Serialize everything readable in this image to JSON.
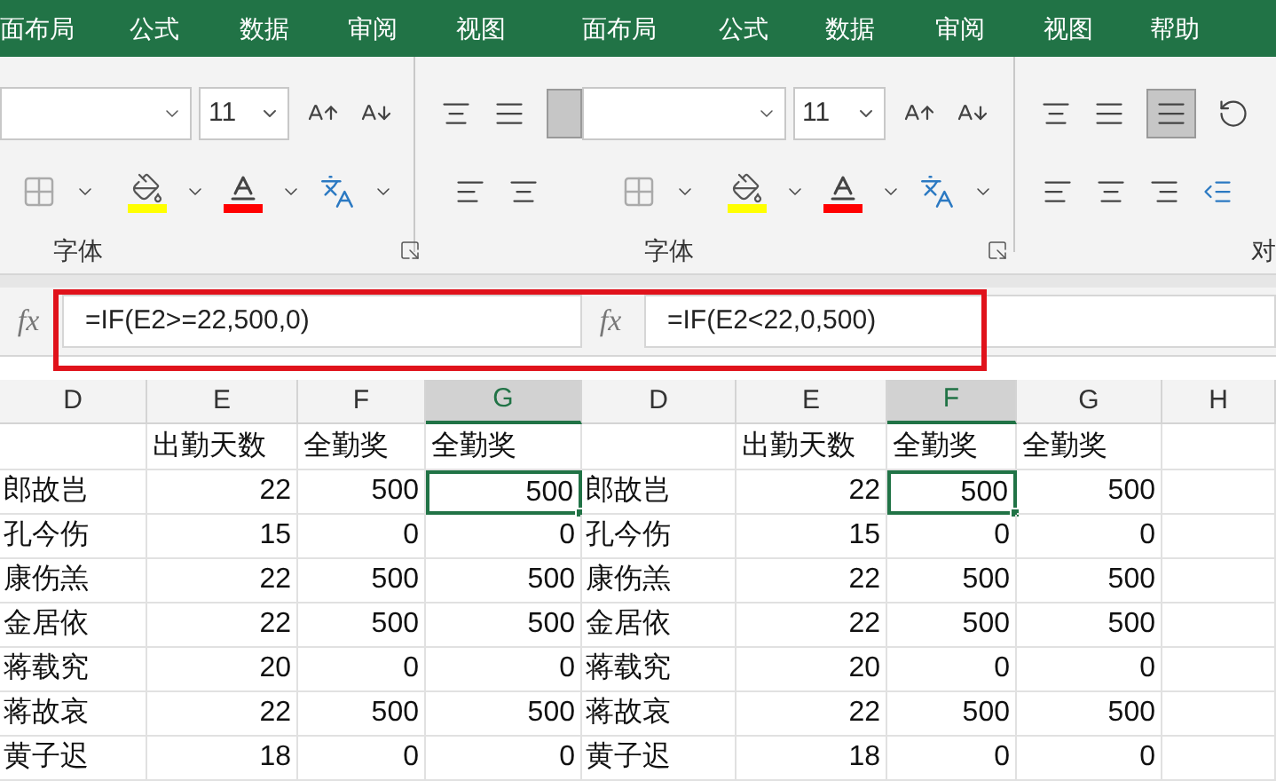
{
  "formula_highlight": true,
  "panels": [
    {
      "tabs": [
        "面布局",
        "公式",
        "数据",
        "审阅",
        "视图"
      ],
      "font_size": "11",
      "group_label": "字体",
      "fx": "fx",
      "formula": "=IF(E2>=22,500,0)",
      "columns": [
        {
          "letter": "D",
          "selected": false
        },
        {
          "letter": "E",
          "selected": false,
          "heading": "出勤天数"
        },
        {
          "letter": "F",
          "selected": false,
          "heading": "全勤奖"
        },
        {
          "letter": "G",
          "selected": true,
          "heading": "全勤奖"
        }
      ],
      "rows": [
        {
          "cells": [
            {
              "text": "郎故岂",
              "selected": false
            },
            {
              "text": "22",
              "selected": false
            },
            {
              "text": "500",
              "selected": false
            },
            {
              "text": "500",
              "selected": true
            }
          ]
        },
        {
          "cells": [
            {
              "text": "孔今伤",
              "selected": false
            },
            {
              "text": "15",
              "selected": false
            },
            {
              "text": "0",
              "selected": false
            },
            {
              "text": "0",
              "selected": false
            }
          ]
        },
        {
          "cells": [
            {
              "text": "康伤羔",
              "selected": false
            },
            {
              "text": "22",
              "selected": false
            },
            {
              "text": "500",
              "selected": false
            },
            {
              "text": "500",
              "selected": false
            }
          ]
        },
        {
          "cells": [
            {
              "text": "金居依",
              "selected": false
            },
            {
              "text": "22",
              "selected": false
            },
            {
              "text": "500",
              "selected": false
            },
            {
              "text": "500",
              "selected": false
            }
          ]
        },
        {
          "cells": [
            {
              "text": "蒋载究",
              "selected": false
            },
            {
              "text": "20",
              "selected": false
            },
            {
              "text": "0",
              "selected": false
            },
            {
              "text": "0",
              "selected": false
            }
          ]
        },
        {
          "cells": [
            {
              "text": "蒋故哀",
              "selected": false
            },
            {
              "text": "22",
              "selected": false
            },
            {
              "text": "500",
              "selected": false
            },
            {
              "text": "500",
              "selected": false
            }
          ]
        },
        {
          "cells": [
            {
              "text": "黄子迟",
              "selected": false
            },
            {
              "text": "18",
              "selected": false
            },
            {
              "text": "0",
              "selected": false
            },
            {
              "text": "0",
              "selected": false
            }
          ]
        }
      ]
    },
    {
      "tabs": [
        "面布局",
        "公式",
        "数据",
        "审阅",
        "视图",
        "帮助"
      ],
      "font_size": "11",
      "group_label": "字体",
      "next_group_label": "对",
      "fx": "fx",
      "formula": "=IF(E2<22,0,500)",
      "columns": [
        {
          "letter": "D",
          "selected": false
        },
        {
          "letter": "E",
          "selected": false,
          "heading": "出勤天数"
        },
        {
          "letter": "F",
          "selected": true,
          "heading": "全勤奖"
        },
        {
          "letter": "G",
          "selected": false,
          "heading": "全勤奖"
        },
        {
          "letter": "H",
          "selected": false
        }
      ],
      "rows": [
        {
          "cells": [
            {
              "text": "郎故岂",
              "selected": false
            },
            {
              "text": "22",
              "selected": false
            },
            {
              "text": "500",
              "selected": true
            },
            {
              "text": "500",
              "selected": false
            }
          ]
        },
        {
          "cells": [
            {
              "text": "孔今伤",
              "selected": false
            },
            {
              "text": "15",
              "selected": false
            },
            {
              "text": "0",
              "selected": false
            },
            {
              "text": "0",
              "selected": false
            }
          ]
        },
        {
          "cells": [
            {
              "text": "康伤羔",
              "selected": false
            },
            {
              "text": "22",
              "selected": false
            },
            {
              "text": "500",
              "selected": false
            },
            {
              "text": "500",
              "selected": false
            }
          ]
        },
        {
          "cells": [
            {
              "text": "金居依",
              "selected": false
            },
            {
              "text": "22",
              "selected": false
            },
            {
              "text": "500",
              "selected": false
            },
            {
              "text": "500",
              "selected": false
            }
          ]
        },
        {
          "cells": [
            {
              "text": "蒋载究",
              "selected": false
            },
            {
              "text": "20",
              "selected": false
            },
            {
              "text": "0",
              "selected": false
            },
            {
              "text": "0",
              "selected": false
            }
          ]
        },
        {
          "cells": [
            {
              "text": "蒋故哀",
              "selected": false
            },
            {
              "text": "22",
              "selected": false
            },
            {
              "text": "500",
              "selected": false
            },
            {
              "text": "500",
              "selected": false
            }
          ]
        },
        {
          "cells": [
            {
              "text": "黄子迟",
              "selected": false
            },
            {
              "text": "18",
              "selected": false
            },
            {
              "text": "0",
              "selected": false
            },
            {
              "text": "0",
              "selected": false
            }
          ]
        }
      ]
    }
  ]
}
